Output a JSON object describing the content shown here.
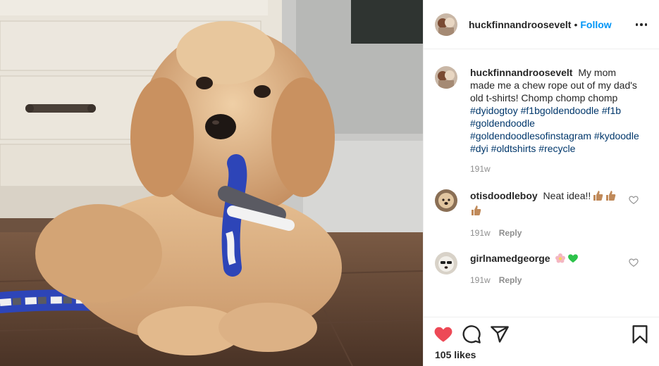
{
  "post": {
    "username": "huckfinnandroosevelt",
    "separator": "•",
    "follow_label": "Follow",
    "more_icon": "more-options-icon",
    "photo_subject": "goldendoodle-puppy-with-chew-rope"
  },
  "caption": {
    "username": "huckfinnandroosevelt",
    "text": "My mom made me a chew rope out of my dad's old t-shirts! Chomp chomp chomp",
    "hashtags": [
      "#dyidogtoy",
      "#f1bgoldendoodle",
      "#f1b",
      "#goldendoodle",
      "#goldendoodlesofinstagram",
      "#kydoodle",
      "#dyi",
      "#oldtshirts",
      "#recycle"
    ],
    "age": "191w"
  },
  "comments": [
    {
      "username": "otisdoodleboy",
      "text": "Neat idea!!",
      "emojis": [
        "thumbs-up-icon",
        "thumbs-up-icon",
        "thumbs-up-icon"
      ],
      "age": "191w",
      "reply_label": "Reply"
    },
    {
      "username": "girlnamedgeorge",
      "text": "",
      "emojis": [
        "flower-icon",
        "green-heart-icon"
      ],
      "age": "191w",
      "reply_label": "Reply"
    }
  ],
  "actions": {
    "like_icon": "heart-filled-icon",
    "comment_icon": "comment-icon",
    "share_icon": "share-icon",
    "save_icon": "bookmark-icon",
    "likes_count": "105 likes"
  },
  "colors": {
    "link_blue": "#0095f6",
    "hashtag_blue": "#00376b",
    "like_red": "#ed4956",
    "muted_gray": "#8e8e8e",
    "text": "#262626"
  }
}
